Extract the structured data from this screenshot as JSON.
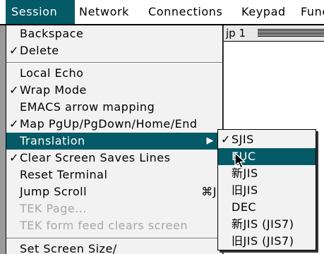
{
  "menubar": {
    "items": [
      {
        "label": "Session",
        "active": true
      },
      {
        "label": "Network",
        "active": false
      },
      {
        "label": "Connections",
        "active": false
      },
      {
        "label": "Keypad",
        "active": false
      },
      {
        "label": "Func",
        "active": false
      }
    ]
  },
  "window": {
    "title": "jp 1"
  },
  "session_menu": {
    "items": [
      {
        "label": "Backspace",
        "checked": false
      },
      {
        "label": "Delete",
        "checked": true,
        "check": "✓"
      },
      {
        "label": "Local Echo",
        "checked": false
      },
      {
        "label": "Wrap Mode",
        "checked": true,
        "check": "✓"
      },
      {
        "label": "EMACS arrow mapping",
        "checked": false
      },
      {
        "label": "Map PgUp/PgDown/Home/End",
        "checked": true,
        "check": "✓"
      },
      {
        "label": "Translation",
        "checked": false,
        "submenu_arrow": "▶",
        "highlighted": true
      },
      {
        "label": "Clear Screen Saves Lines",
        "checked": true,
        "check": "✓"
      },
      {
        "label": "Reset Terminal",
        "checked": false
      },
      {
        "label": "Jump Scroll",
        "checked": false,
        "shortcut": "⌘J"
      },
      {
        "label": "TEK Page...",
        "checked": false,
        "disabled": true
      },
      {
        "label": "TEK form feed clears screen",
        "checked": false,
        "disabled": true
      },
      {
        "label": "Set Screen Size/",
        "checked": false
      }
    ]
  },
  "translation_submenu": {
    "items": [
      {
        "label": "SJIS",
        "checked": true,
        "check": "✓"
      },
      {
        "label": "EUC",
        "checked": false,
        "highlighted": true
      },
      {
        "label": "新JIS",
        "checked": false
      },
      {
        "label": "旧JIS",
        "checked": false
      },
      {
        "label": "DEC",
        "checked": false
      },
      {
        "label": "新JIS (JIS7)",
        "checked": false
      },
      {
        "label": "旧JIS (JIS7)",
        "checked": false
      }
    ]
  },
  "colors": {
    "highlight": "#045a66",
    "menu_background": "#f2f2f2",
    "disabled_text": "#a6a6a6"
  },
  "icons": {
    "check": "checkmark-icon",
    "submenu": "triangle-right-icon",
    "pointer": "mouse-pointer-icon"
  }
}
